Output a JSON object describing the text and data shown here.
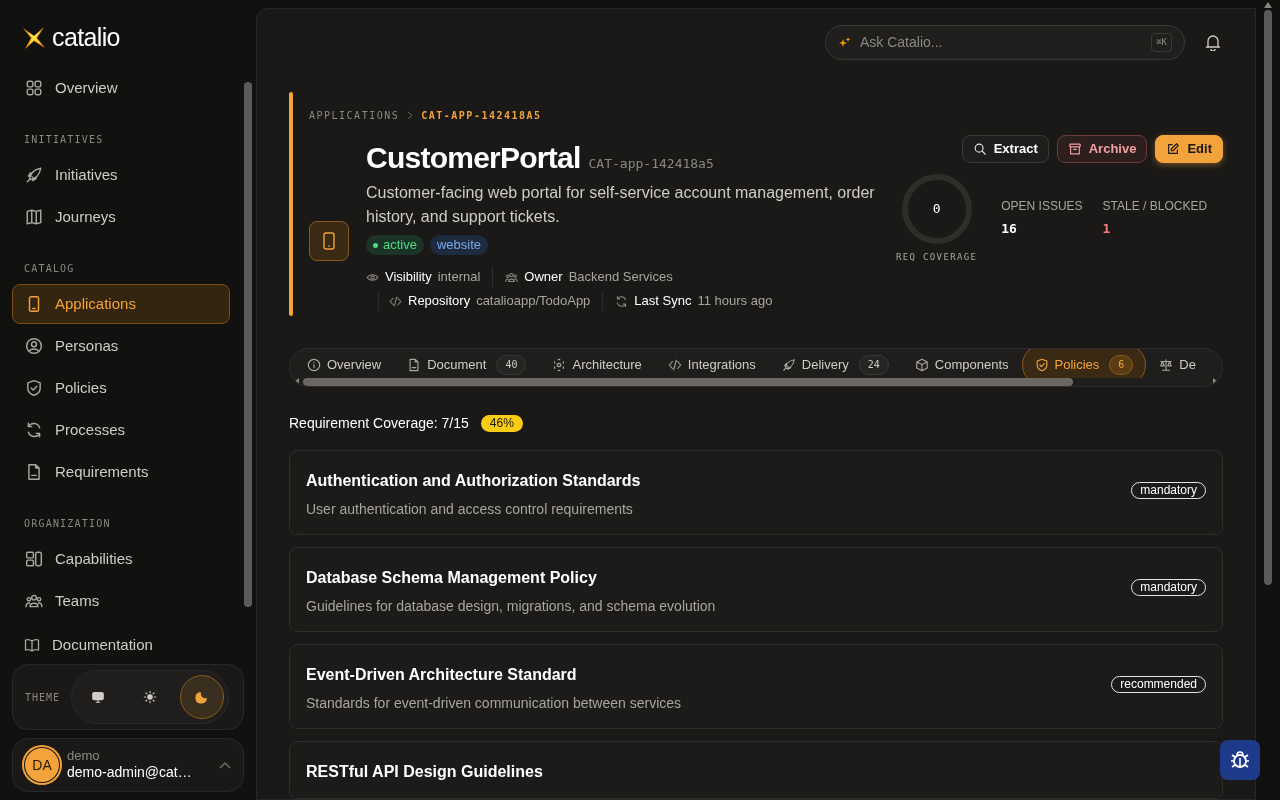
{
  "brand": {
    "name": "catalio"
  },
  "sidebar": {
    "sections": [
      {
        "items": [
          {
            "label": "Overview",
            "selected": false
          }
        ]
      },
      {
        "heading": "INITIATIVES",
        "items": [
          {
            "label": "Initiatives",
            "selected": false
          },
          {
            "label": "Journeys",
            "selected": false
          }
        ]
      },
      {
        "heading": "CATALOG",
        "items": [
          {
            "label": "Applications",
            "selected": true
          },
          {
            "label": "Personas",
            "selected": false
          },
          {
            "label": "Policies",
            "selected": false
          },
          {
            "label": "Processes",
            "selected": false
          },
          {
            "label": "Requirements",
            "selected": false
          }
        ]
      },
      {
        "heading": "ORGANIZATION",
        "items": [
          {
            "label": "Capabilities",
            "selected": false
          },
          {
            "label": "Teams",
            "selected": false
          }
        ]
      }
    ],
    "documentation": "Documentation",
    "theme": {
      "label": "THEME",
      "options": [
        {
          "selected": false
        },
        {
          "selected": false
        },
        {
          "selected": true
        }
      ]
    },
    "user": {
      "initials": "DA",
      "name": "demo",
      "email": "demo-admin@cat…"
    }
  },
  "search": {
    "placeholder": "Ask Catalio...",
    "shortcut": "⌘K"
  },
  "breadcrumb": [
    "APPLICATIONS",
    "CAT-APP-142418A5"
  ],
  "app": {
    "name": "CustomerPortal",
    "id": "CAT-app-142418a5",
    "description": "Customer-facing web portal for self-service account management, order history, and support tickets.",
    "tags": [
      {
        "label": "active",
        "kind": "status"
      },
      {
        "label": "website",
        "kind": "type"
      }
    ],
    "meta": [
      [
        {
          "label": "Visibility",
          "value": "internal"
        },
        {
          "label": "Owner",
          "value": "Backend Services"
        }
      ],
      [
        {
          "label": "Repository",
          "value": "catalioapp/TodoApp"
        },
        {
          "label": "Last Sync",
          "value": "11 hours ago"
        }
      ]
    ]
  },
  "actions": [
    {
      "label": "Extract",
      "kind": "neutral"
    },
    {
      "label": "Archive",
      "kind": "danger"
    },
    {
      "label": "Edit",
      "kind": "primary"
    }
  ],
  "coverage_ring": {
    "value": "0",
    "label": "REQ COVERAGE"
  },
  "stats": [
    {
      "label": "OPEN ISSUES",
      "value": "16",
      "kind": "normal"
    },
    {
      "label": "STALE / BLOCKED",
      "value": "1",
      "kind": "alert"
    }
  ],
  "tabs": [
    {
      "label": "Overview",
      "selected": false
    },
    {
      "label": "Document",
      "count": "40",
      "selected": false
    },
    {
      "label": "Architecture",
      "selected": false
    },
    {
      "label": "Integrations",
      "selected": false
    },
    {
      "label": "Delivery",
      "count": "24",
      "selected": false
    },
    {
      "label": "Components",
      "selected": false
    },
    {
      "label": "Policies",
      "count": "6",
      "selected": true
    },
    {
      "label": "De",
      "selected": false
    }
  ],
  "requirement_coverage": {
    "label": "Requirement Coverage: 7/15",
    "percent": "46%"
  },
  "policies": [
    {
      "title": "Authentication and Authorization Standards",
      "description": "User authentication and access control requirements",
      "level": "mandatory"
    },
    {
      "title": "Database Schema Management Policy",
      "description": "Guidelines for database design, migrations, and schema evolution",
      "level": "mandatory"
    },
    {
      "title": "Event-Driven Architecture Standard",
      "description": "Standards for event-driven communication between services",
      "level": "recommended"
    },
    {
      "title": "RESTful API Design Guidelines"
    }
  ]
}
